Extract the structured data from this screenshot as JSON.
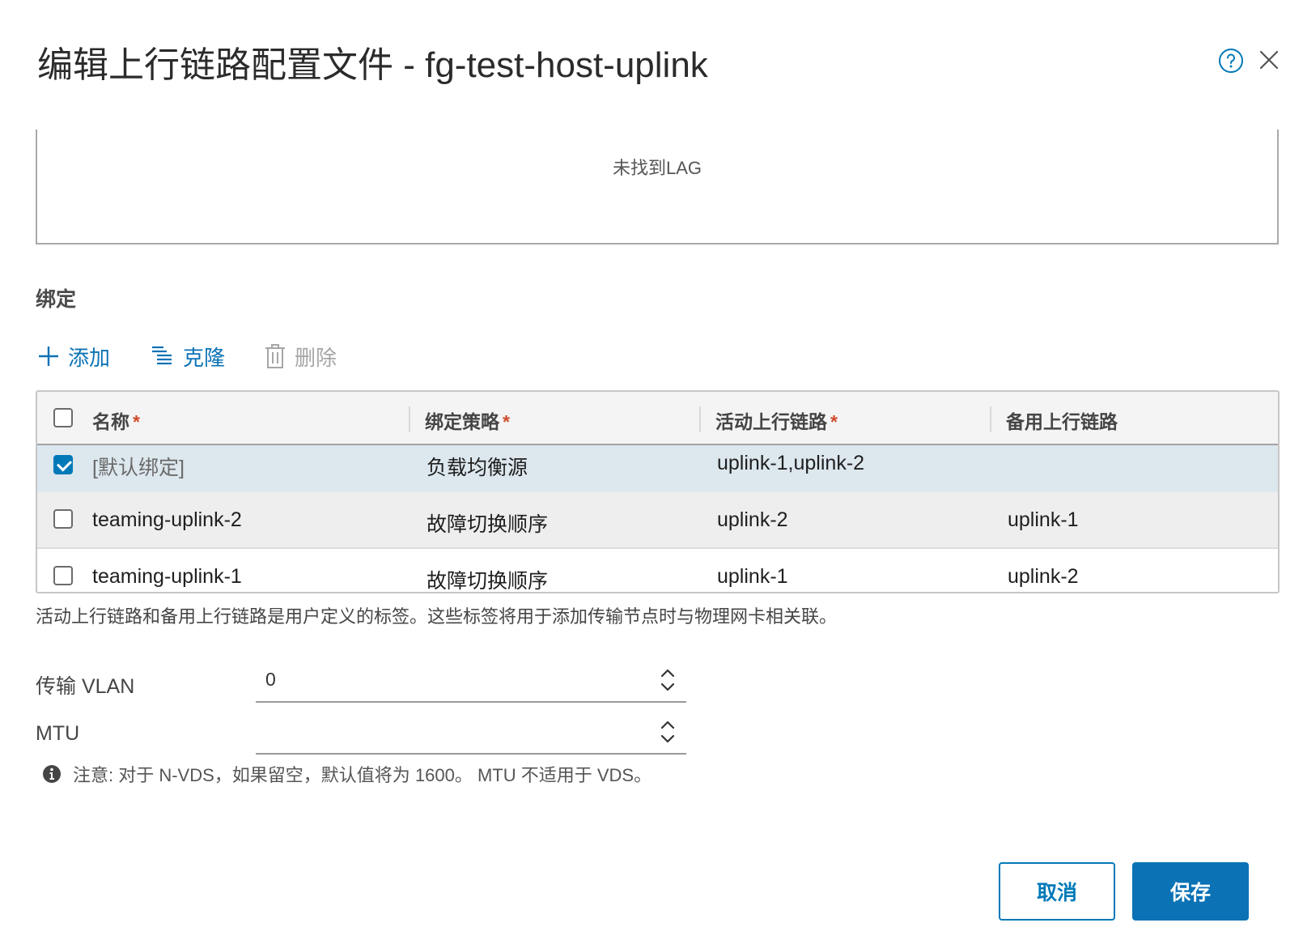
{
  "dialog": {
    "title": "编辑上行链路配置文件 - fg-test-host-uplink"
  },
  "lag": {
    "empty_text": "未找到LAG"
  },
  "teaming": {
    "section_title": "绑定",
    "toolbar": {
      "add_label": "添加",
      "clone_label": "克隆",
      "delete_label": "删除"
    },
    "columns": [
      {
        "label": "名称",
        "required": "*"
      },
      {
        "label": "绑定策略",
        "required": "*"
      },
      {
        "label": "活动上行链路",
        "required": "*"
      },
      {
        "label": "备用上行链路",
        "required": ""
      }
    ],
    "rows": [
      {
        "name": "[默认绑定]",
        "policy": "负载均衡源",
        "active": "uplink-1,uplink-2",
        "standby": "",
        "checked": true
      },
      {
        "name": "teaming-uplink-2",
        "policy": "故障切换顺序",
        "active": "uplink-2",
        "standby": "uplink-1",
        "checked": false
      },
      {
        "name": "teaming-uplink-1",
        "policy": "故障切换顺序",
        "active": "uplink-1",
        "standby": "uplink-2",
        "checked": false
      }
    ],
    "hint": "活动上行链路和备用上行链路是用户定义的标签。这些标签将用于添加传输节点时与物理网卡相关联。"
  },
  "fields": {
    "vlan_label": "传输 VLAN",
    "vlan_value": "0",
    "mtu_label": "MTU",
    "mtu_value": ""
  },
  "note": "注意: 对于 N-VDS，如果留空，默认值将为 1600。 MTU 不适用于 VDS。",
  "footer": {
    "cancel_label": "取消",
    "save_label": "保存"
  },
  "colors": {
    "accent": "#0079b8",
    "selected_row": "#dde7ee",
    "row_alt": "#eeeeee",
    "required": "#d14b2b"
  }
}
